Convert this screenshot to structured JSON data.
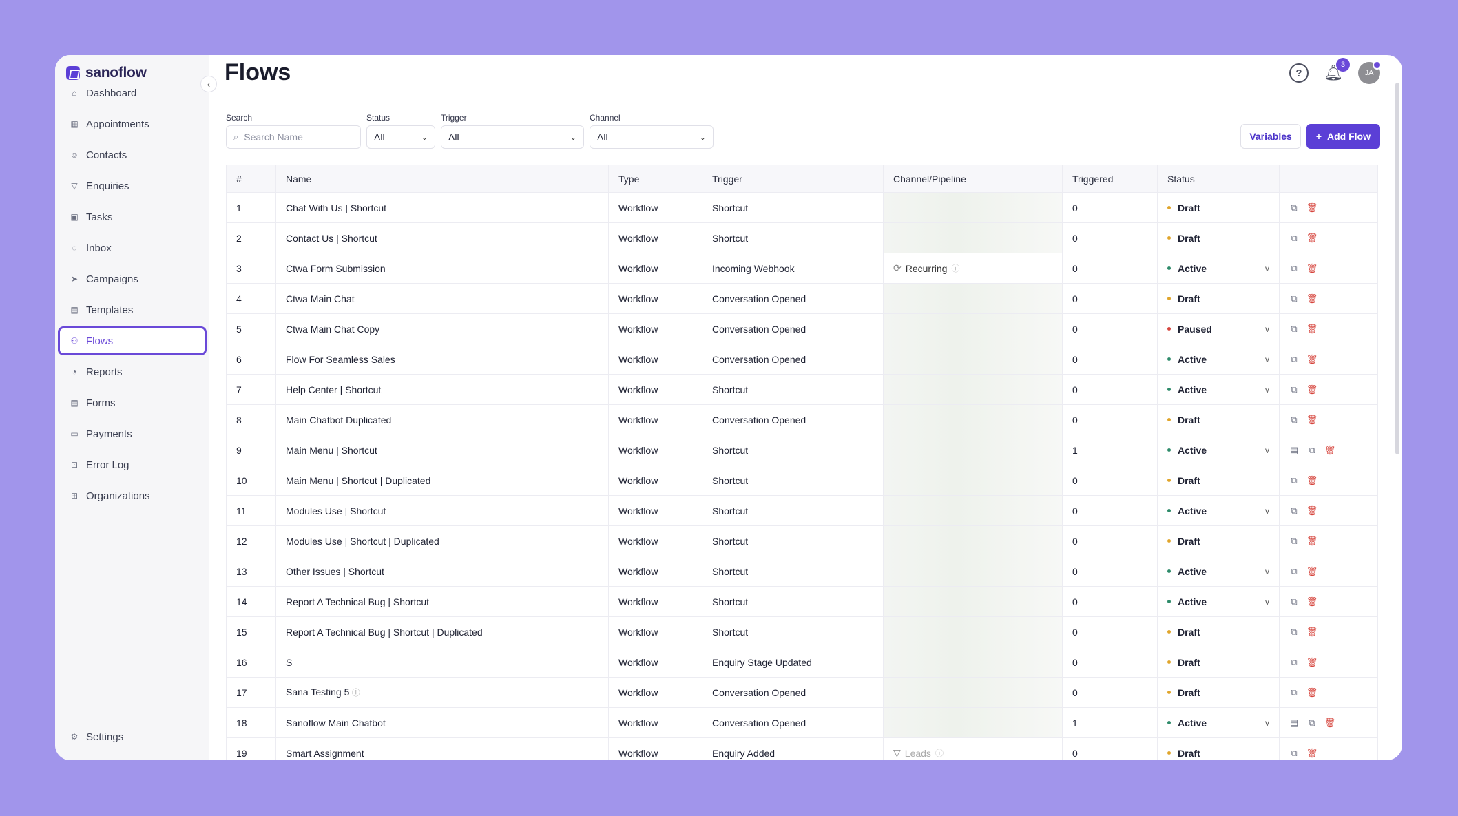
{
  "brand": "sanoflow",
  "page_title": "Flows",
  "notifications_count": "3",
  "avatar_initials": "JA",
  "sidebar": {
    "items": [
      {
        "label": "Dashboard",
        "icon": "home-icon",
        "glyph": "⌂"
      },
      {
        "label": "Appointments",
        "icon": "calendar-icon",
        "glyph": "▦"
      },
      {
        "label": "Contacts",
        "icon": "users-icon",
        "glyph": "☺"
      },
      {
        "label": "Enquiries",
        "icon": "filter-icon",
        "glyph": "▽"
      },
      {
        "label": "Tasks",
        "icon": "task-icon",
        "glyph": "▣"
      },
      {
        "label": "Inbox",
        "icon": "chat-icon",
        "glyph": "◌"
      },
      {
        "label": "Campaigns",
        "icon": "send-icon",
        "glyph": "➤"
      },
      {
        "label": "Templates",
        "icon": "template-icon",
        "glyph": "▤"
      },
      {
        "label": "Flows",
        "icon": "flow-icon",
        "glyph": "⚇",
        "active": true
      },
      {
        "label": "Reports",
        "icon": "report-icon",
        "glyph": "◔"
      },
      {
        "label": "Forms",
        "icon": "form-icon",
        "glyph": "▤"
      },
      {
        "label": "Payments",
        "icon": "payment-icon",
        "glyph": "▭"
      },
      {
        "label": "Error Log",
        "icon": "lock-icon",
        "glyph": "⊡"
      },
      {
        "label": "Organizations",
        "icon": "building-icon",
        "glyph": "⊞"
      }
    ],
    "settings_label": "Settings"
  },
  "filters": {
    "search_label": "Search",
    "search_placeholder": "Search Name",
    "status_label": "Status",
    "status_value": "All",
    "trigger_label": "Trigger",
    "trigger_value": "All",
    "channel_label": "Channel",
    "channel_value": "All"
  },
  "buttons": {
    "variables": "Variables",
    "add_flow": "Add Flow"
  },
  "table": {
    "headers": [
      "#",
      "Name",
      "Type",
      "Trigger",
      "Channel/Pipeline",
      "Triggered",
      "Status",
      ""
    ],
    "rows": [
      {
        "num": "1",
        "name": "Chat With Us | Shortcut",
        "type": "Workflow",
        "trigger": "Shortcut",
        "channel": "",
        "triggered": "0",
        "status": "Draft",
        "dropdown": false,
        "doc": false
      },
      {
        "num": "2",
        "name": "Contact Us | Shortcut",
        "type": "Workflow",
        "trigger": "Shortcut",
        "channel": "",
        "triggered": "0",
        "status": "Draft",
        "dropdown": false,
        "doc": false
      },
      {
        "num": "3",
        "name": "Ctwa Form Submission",
        "type": "Workflow",
        "trigger": "Incoming Webhook",
        "channel": "Recurring",
        "triggered": "0",
        "status": "Active",
        "dropdown": true,
        "doc": false
      },
      {
        "num": "4",
        "name": "Ctwa Main Chat",
        "type": "Workflow",
        "trigger": "Conversation Opened",
        "channel": "",
        "triggered": "0",
        "status": "Draft",
        "dropdown": false,
        "doc": false
      },
      {
        "num": "5",
        "name": "Ctwa Main Chat Copy",
        "type": "Workflow",
        "trigger": "Conversation Opened",
        "channel": "",
        "triggered": "0",
        "status": "Paused",
        "dropdown": true,
        "doc": false
      },
      {
        "num": "6",
        "name": "Flow For Seamless Sales",
        "type": "Workflow",
        "trigger": "Conversation Opened",
        "channel": "",
        "triggered": "0",
        "status": "Active",
        "dropdown": true,
        "doc": false
      },
      {
        "num": "7",
        "name": "Help Center | Shortcut",
        "type": "Workflow",
        "trigger": "Shortcut",
        "channel": "",
        "triggered": "0",
        "status": "Active",
        "dropdown": true,
        "doc": false
      },
      {
        "num": "8",
        "name": "Main Chatbot Duplicated",
        "type": "Workflow",
        "trigger": "Conversation Opened",
        "channel": "",
        "triggered": "0",
        "status": "Draft",
        "dropdown": false,
        "doc": false
      },
      {
        "num": "9",
        "name": "Main Menu | Shortcut",
        "type": "Workflow",
        "trigger": "Shortcut",
        "channel": "",
        "triggered": "1",
        "status": "Active",
        "dropdown": true,
        "doc": true
      },
      {
        "num": "10",
        "name": "Main Menu | Shortcut | Duplicated",
        "type": "Workflow",
        "trigger": "Shortcut",
        "channel": "",
        "triggered": "0",
        "status": "Draft",
        "dropdown": false,
        "doc": false
      },
      {
        "num": "11",
        "name": "Modules Use | Shortcut",
        "type": "Workflow",
        "trigger": "Shortcut",
        "channel": "",
        "triggered": "0",
        "status": "Active",
        "dropdown": true,
        "doc": false
      },
      {
        "num": "12",
        "name": "Modules Use | Shortcut | Duplicated",
        "type": "Workflow",
        "trigger": "Shortcut",
        "channel": "",
        "triggered": "0",
        "status": "Draft",
        "dropdown": false,
        "doc": false
      },
      {
        "num": "13",
        "name": "Other Issues | Shortcut",
        "type": "Workflow",
        "trigger": "Shortcut",
        "channel": "",
        "triggered": "0",
        "status": "Active",
        "dropdown": true,
        "doc": false
      },
      {
        "num": "14",
        "name": "Report A Technical Bug | Shortcut",
        "type": "Workflow",
        "trigger": "Shortcut",
        "channel": "",
        "triggered": "0",
        "status": "Active",
        "dropdown": true,
        "doc": false
      },
      {
        "num": "15",
        "name": "Report A Technical Bug | Shortcut | Duplicated",
        "type": "Workflow",
        "trigger": "Shortcut",
        "channel": "",
        "triggered": "0",
        "status": "Draft",
        "dropdown": false,
        "doc": false
      },
      {
        "num": "16",
        "name": "S",
        "type": "Workflow",
        "trigger": "Enquiry Stage Updated",
        "channel": "",
        "triggered": "0",
        "status": "Draft",
        "dropdown": false,
        "doc": false
      },
      {
        "num": "17",
        "name": "Sana Testing 5",
        "type": "Workflow",
        "trigger": "Conversation Opened",
        "channel": "",
        "triggered": "0",
        "status": "Draft",
        "dropdown": false,
        "doc": false
      },
      {
        "num": "18",
        "name": "Sanoflow Main Chatbot",
        "type": "Workflow",
        "trigger": "Conversation Opened",
        "channel": "",
        "triggered": "1",
        "status": "Active",
        "dropdown": true,
        "doc": true
      },
      {
        "num": "19",
        "name": "Smart Assignment",
        "type": "Workflow",
        "trigger": "Enquiry Added",
        "channel": "Leads",
        "triggered": "0",
        "status": "Draft",
        "dropdown": false,
        "doc": false
      }
    ]
  },
  "colors": {
    "accent": "#5b3fd6",
    "draft": "#e0a52b",
    "active": "#2e8b6a",
    "paused": "#d6453d"
  }
}
